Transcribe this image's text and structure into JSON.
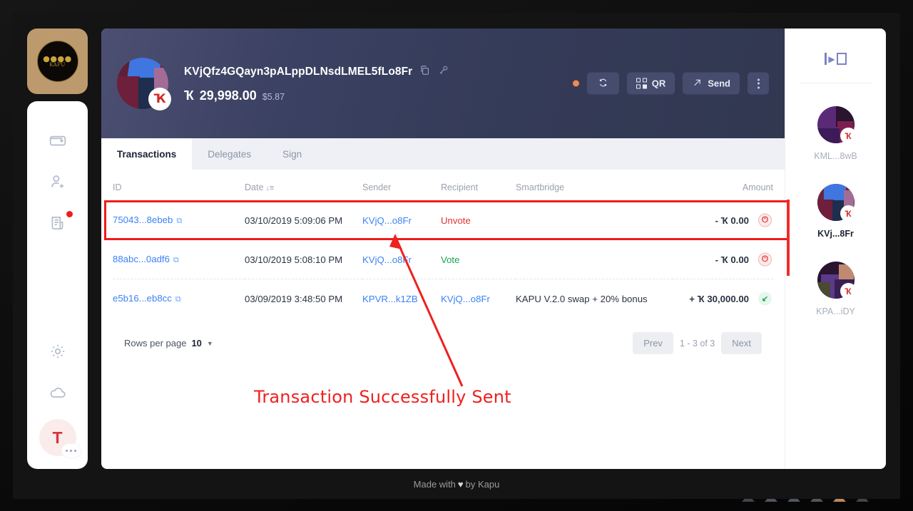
{
  "app": {
    "logo_glyph": "Ҡ",
    "logo_sub": "KAPU",
    "footer_prefix": "Made with",
    "footer_heart": "♥",
    "footer_suffix": "by Kapu"
  },
  "left_rail": {
    "items": [
      {
        "name": "wallet-icon",
        "label": "Wallets",
        "badge": false
      },
      {
        "name": "add-contact-icon",
        "label": "Add Contact",
        "badge": false
      },
      {
        "name": "document-icon",
        "label": "News",
        "badge": true
      },
      {
        "name": "gear-icon",
        "label": "Settings",
        "badge": false
      },
      {
        "name": "cloud-icon",
        "label": "Network",
        "badge": false
      }
    ],
    "profile": {
      "initial": "T",
      "label": "Profile"
    }
  },
  "wallet": {
    "address": "KVjQfz4GQayn3pALppDLNsdLMEL5fLo8Fr",
    "copy_icon": "copy-icon",
    "key_icon": "key-icon",
    "balance_symbol": "Ҡ",
    "balance": "29,998.00",
    "fiat": "$5.87",
    "status_color": "#f08b4e",
    "actions": {
      "refresh_label": "Refresh",
      "qr_label": "QR",
      "send_label": "Send",
      "more_label": "More"
    }
  },
  "tabs": [
    {
      "label": "Transactions",
      "active": true
    },
    {
      "label": "Delegates",
      "active": false
    },
    {
      "label": "Sign",
      "active": false
    }
  ],
  "table": {
    "columns": [
      "ID",
      "Date",
      "Sender",
      "Recipient",
      "Smartbridge",
      "Amount"
    ],
    "sort_column": "Date",
    "sort_indicator": "↓≡",
    "rows": [
      {
        "id": "75043...8ebeb",
        "date": "03/10/2019 5:09:06 PM",
        "sender": "KVjQ...o8Fr",
        "recipient": "Unvote",
        "recipient_type": "unvote",
        "smartbridge": "",
        "amount": "- Ҡ 0.00",
        "direction": "out",
        "highlighted": true
      },
      {
        "id": "88abc...0adf6",
        "date": "03/10/2019 5:08:10 PM",
        "sender": "KVjQ...o8Fr",
        "recipient": "Vote",
        "recipient_type": "vote",
        "smartbridge": "",
        "amount": "- Ҡ 0.00",
        "direction": "out",
        "highlighted": false
      },
      {
        "id": "e5b16...eb8cc",
        "date": "03/09/2019 3:48:50 PM",
        "sender": "KPVR...k1ZB",
        "recipient": "KVjQ...o8Fr",
        "recipient_type": "address",
        "smartbridge": "KAPU V.2.0 swap + 20% bonus",
        "amount": "+ Ҡ 30,000.00",
        "direction": "in",
        "highlighted": false
      }
    ]
  },
  "pagination": {
    "rows_per_page_label": "Rows per page",
    "rows_per_page_value": "10",
    "prev_label": "Prev",
    "range_label": "1 - 3 of 3",
    "next_label": "Next"
  },
  "right_sidebar": {
    "collapse_icon": "collapse-sidebar-icon",
    "wallets": [
      {
        "label": "KML...8wB",
        "active": false,
        "badge": "Ҡ"
      },
      {
        "label": "KVj...8Fr",
        "active": true,
        "badge": "Ҡ"
      },
      {
        "label": "KPA...iDY",
        "active": false,
        "badge": "Ҡ"
      }
    ]
  },
  "annotation": {
    "text": "Transaction Successfully Sent",
    "color": "#ef2020"
  }
}
